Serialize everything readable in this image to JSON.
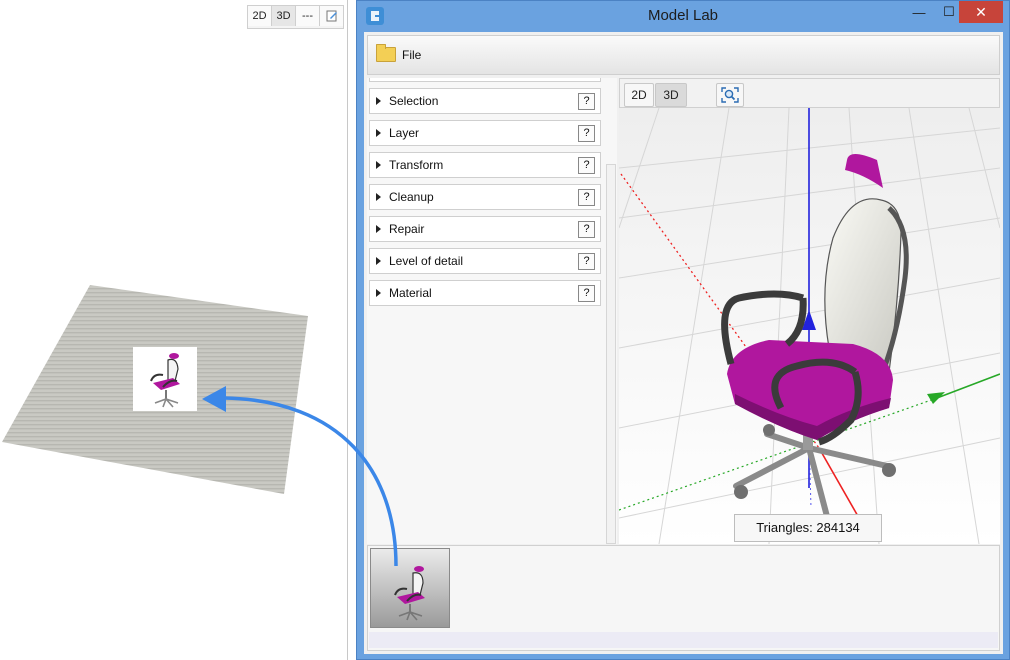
{
  "left_toolbar": {
    "btn_2d": "2D",
    "btn_3d": "3D",
    "btn_dash": "---"
  },
  "window": {
    "title": "Model Lab",
    "controls": {
      "minimize": "—",
      "maximize": "☐",
      "close": "✕"
    }
  },
  "menu": {
    "file_label": "File"
  },
  "panel": {
    "sections": [
      {
        "label": "Selection",
        "help": "?"
      },
      {
        "label": "Layer",
        "help": "?"
      },
      {
        "label": "Transform",
        "help": "?"
      },
      {
        "label": "Cleanup",
        "help": "?"
      },
      {
        "label": "Repair",
        "help": "?"
      },
      {
        "label": "Level of detail",
        "help": "?"
      },
      {
        "label": "Material",
        "help": "?"
      }
    ]
  },
  "viewport": {
    "btn_2d": "2D",
    "btn_3d": "3D",
    "triangles_label": "Triangles: 284134"
  },
  "colors": {
    "accent_blue": "#3b87e8",
    "seat_magenta": "#b0179e",
    "window_frame": "#6aa2e0"
  }
}
